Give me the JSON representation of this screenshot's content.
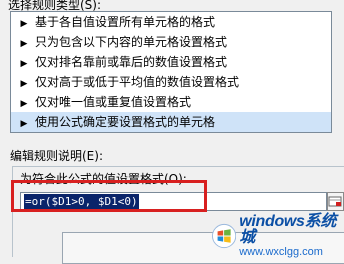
{
  "rule_type_section": {
    "label": "选择规则类型(S):",
    "items": [
      {
        "label": "基于各自值设置所有单元格的格式",
        "selected": false
      },
      {
        "label": "只为包含以下内容的单元格设置格式",
        "selected": false
      },
      {
        "label": "仅对排名靠前或靠后的数值设置格式",
        "selected": false
      },
      {
        "label": "仅对高于或低于平均值的数值设置格式",
        "selected": false
      },
      {
        "label": "仅对唯一值或重复值设置格式",
        "selected": false
      },
      {
        "label": "使用公式确定要设置格式的单元格",
        "selected": true
      }
    ]
  },
  "description_section": {
    "label": "编辑规则说明(E):",
    "formula_label": "为符合此公式的值设置格式(O):",
    "formula_value": "=or($D1>0, $D1<0)"
  },
  "watermark": {
    "title": "windows系统城",
    "domain": "www.wxclgg.com"
  },
  "colors": {
    "highlight_box": "#d82020",
    "selection": "#cfe3f8"
  }
}
